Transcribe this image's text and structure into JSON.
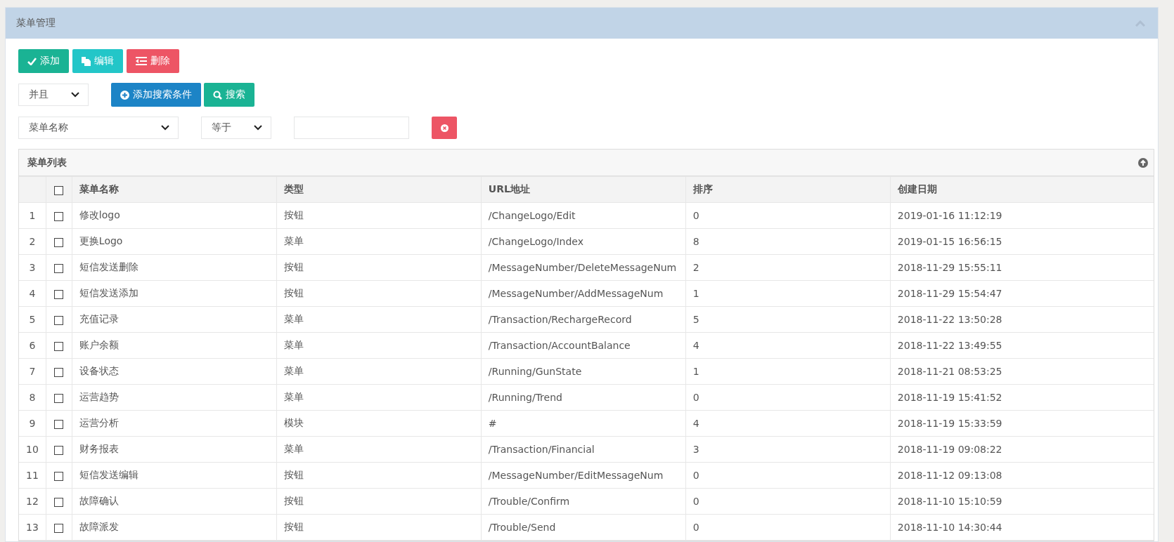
{
  "panel": {
    "title": "菜单管理"
  },
  "toolbar": [
    {
      "label": "添加",
      "kind": "add"
    },
    {
      "label": "编辑",
      "kind": "edit"
    },
    {
      "label": "删除",
      "kind": "delete"
    }
  ],
  "search": {
    "logic": "并且",
    "add_condition": "添加搜索条件",
    "search": "搜索",
    "field": "菜单名称",
    "operator": "等于"
  },
  "table": {
    "title": "菜单列表",
    "all_checked": false,
    "columns": [
      "菜单名称",
      "类型",
      "URL地址",
      "排序",
      "创建日期"
    ],
    "rows": [
      {
        "index": "1",
        "checked": false,
        "cells": [
          "修改logo",
          "按钮",
          "/ChangeLogo/Edit",
          "0",
          "2019-01-16 11:12:19"
        ]
      },
      {
        "index": "2",
        "checked": false,
        "cells": [
          "更换Logo",
          "菜单",
          "/ChangeLogo/Index",
          "8",
          "2019-01-15 16:56:15"
        ]
      },
      {
        "index": "3",
        "checked": false,
        "cells": [
          "短信发送删除",
          "按钮",
          "/MessageNumber/DeleteMessageNum",
          "2",
          "2018-11-29 15:55:11"
        ]
      },
      {
        "index": "4",
        "checked": false,
        "cells": [
          "短信发送添加",
          "按钮",
          "/MessageNumber/AddMessageNum",
          "1",
          "2018-11-29 15:54:47"
        ]
      },
      {
        "index": "5",
        "checked": false,
        "cells": [
          "充值记录",
          "菜单",
          "/Transaction/RechargeRecord",
          "5",
          "2018-11-22 13:50:28"
        ]
      },
      {
        "index": "6",
        "checked": false,
        "cells": [
          "账户余额",
          "菜单",
          "/Transaction/AccountBalance",
          "4",
          "2018-11-22 13:49:55"
        ]
      },
      {
        "index": "7",
        "checked": false,
        "cells": [
          "设备状态",
          "菜单",
          "/Running/GunState",
          "1",
          "2018-11-21 08:53:25"
        ]
      },
      {
        "index": "8",
        "checked": false,
        "cells": [
          "运营趋势",
          "菜单",
          "/Running/Trend",
          "0",
          "2018-11-19 15:41:52"
        ]
      },
      {
        "index": "9",
        "checked": false,
        "cells": [
          "运营分析",
          "模块",
          "#",
          "4",
          "2018-11-19 15:33:59"
        ]
      },
      {
        "index": "10",
        "checked": false,
        "cells": [
          "财务报表",
          "菜单",
          "/Transaction/Financial",
          "3",
          "2018-11-19 09:08:22"
        ]
      },
      {
        "index": "11",
        "checked": false,
        "cells": [
          "短信发送编辑",
          "按钮",
          "/MessageNumber/EditMessageNum",
          "0",
          "2018-11-12 09:13:08"
        ]
      },
      {
        "index": "12",
        "checked": false,
        "cells": [
          "故障确认",
          "按钮",
          "/Trouble/Confirm",
          "0",
          "2018-11-10 15:10:59"
        ]
      },
      {
        "index": "13",
        "checked": false,
        "cells": [
          "故障派发",
          "按钮",
          "/Trouble/Send",
          "0",
          "2018-11-10 14:30:44"
        ]
      }
    ]
  }
}
